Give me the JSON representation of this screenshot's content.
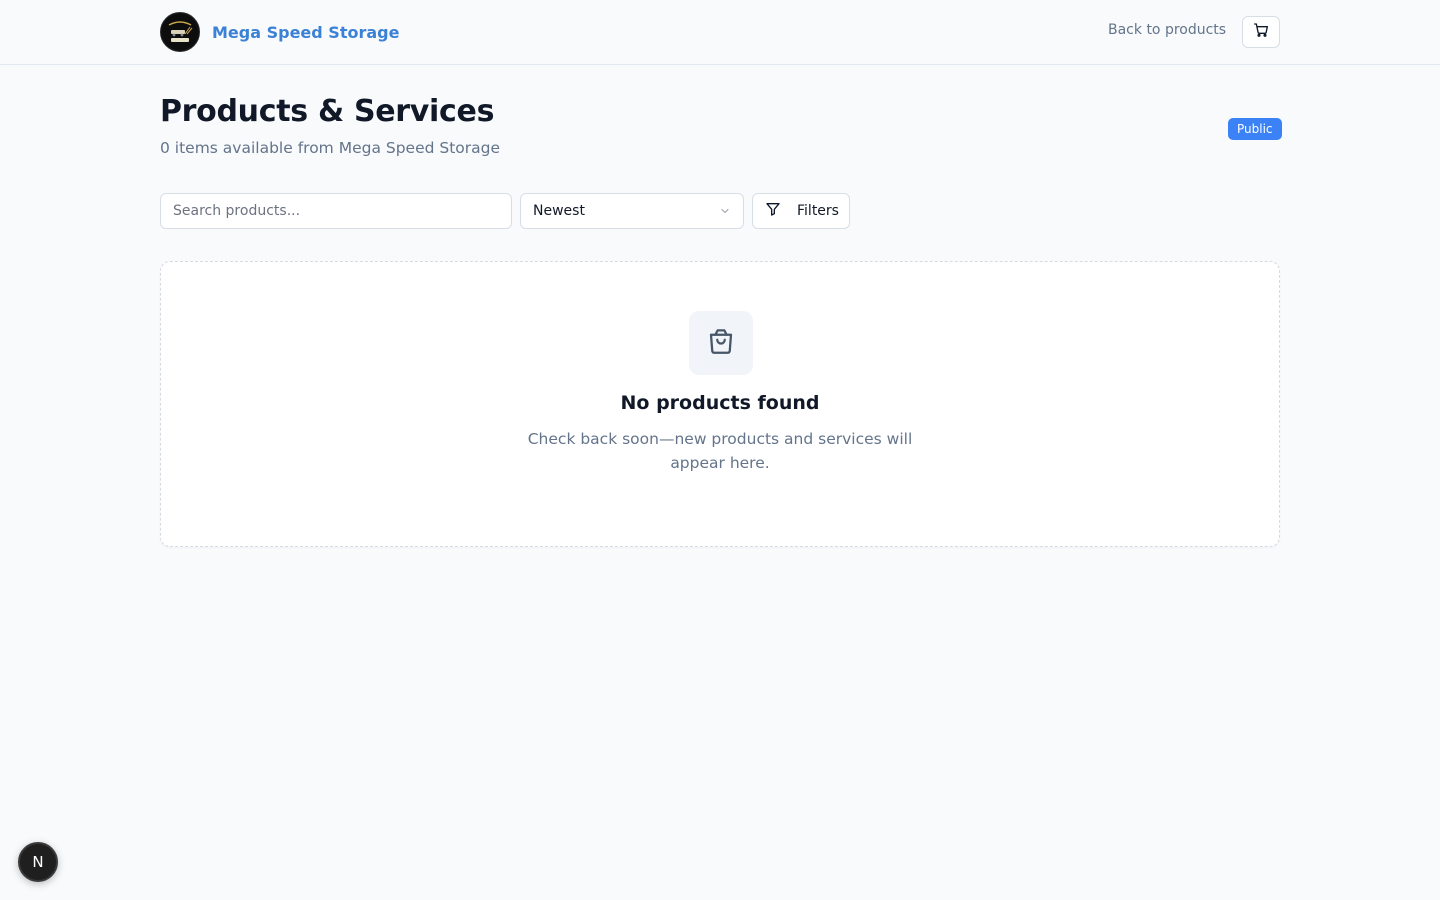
{
  "header": {
    "brand_name": "Mega Speed Storage",
    "logo_icon": "mega-speed-storage-logo",
    "back_link": "Back to products",
    "cart_icon": "cart-icon"
  },
  "page": {
    "title": "Products & Services",
    "subtitle": "0 items available from Mega Speed Storage",
    "badge": "Public"
  },
  "controls": {
    "search_placeholder": "Search products...",
    "search_value": "",
    "sort_value": "Newest",
    "filters_label": "Filters"
  },
  "empty_state": {
    "icon": "shopping-bag-icon",
    "title": "No products found",
    "message": "Check back soon—new products and services will appear here."
  },
  "floating": {
    "bubble_label": "N"
  },
  "colors": {
    "brand": "#3b82d6",
    "badge": "#3b82f6",
    "page_bg": "#f8fafc"
  }
}
